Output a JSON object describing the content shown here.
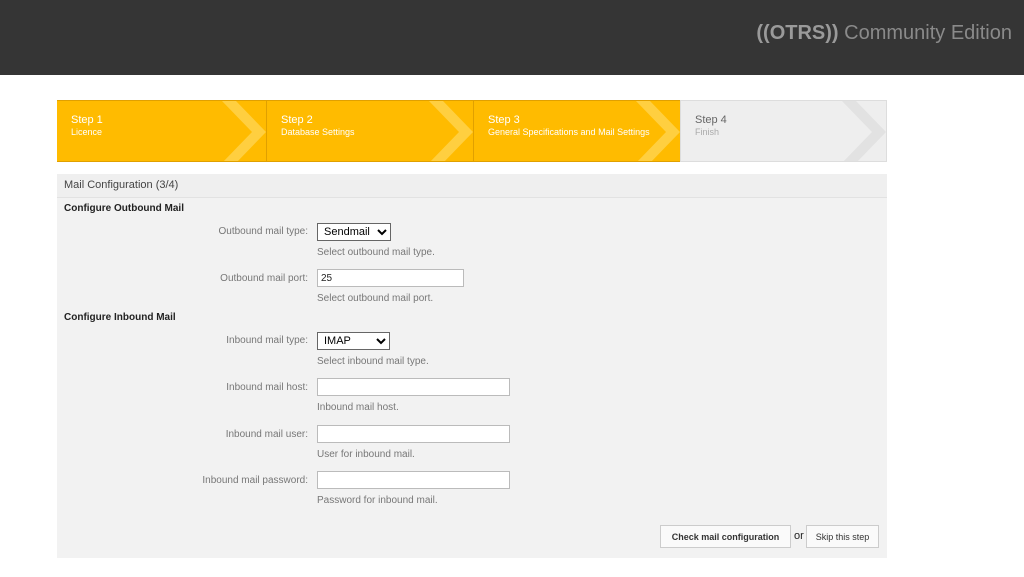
{
  "header": {
    "logo_bold": "((OTRS))",
    "logo_rest": " Community Edition"
  },
  "steps": [
    {
      "title": "Step 1",
      "sub": "Licence",
      "state": "done"
    },
    {
      "title": "Step 2",
      "sub": "Database Settings",
      "state": "done"
    },
    {
      "title": "Step 3",
      "sub": "General Specifications and Mail Settings",
      "state": "done"
    },
    {
      "title": "Step 4",
      "sub": "Finish",
      "state": "todo"
    }
  ],
  "panel": {
    "title": "Mail Configuration (3/4)",
    "outbound": {
      "section_title": "Configure Outbound Mail",
      "type_label": "Outbound mail type:",
      "type_value": "Sendmail",
      "type_hint": "Select outbound mail type.",
      "port_label": "Outbound mail port:",
      "port_value": "25",
      "port_hint": "Select outbound mail port."
    },
    "inbound": {
      "section_title": "Configure Inbound Mail",
      "type_label": "Inbound mail type:",
      "type_value": "IMAP",
      "type_hint": "Select inbound mail type.",
      "host_label": "Inbound mail host:",
      "host_value": "",
      "host_hint": "Inbound mail host.",
      "user_label": "Inbound mail user:",
      "user_value": "",
      "user_hint": "User for inbound mail.",
      "password_label": "Inbound mail password:",
      "password_value": "",
      "password_hint": "Password for inbound mail."
    },
    "actions": {
      "check_label": "Check mail configuration",
      "or_label": "or",
      "skip_label": "Skip this step"
    }
  },
  "colors": {
    "header_bg": "#353535",
    "step_done": "#ffbb00",
    "step_todo": "#eeeeee",
    "panel_bg": "#f2f2f2"
  }
}
